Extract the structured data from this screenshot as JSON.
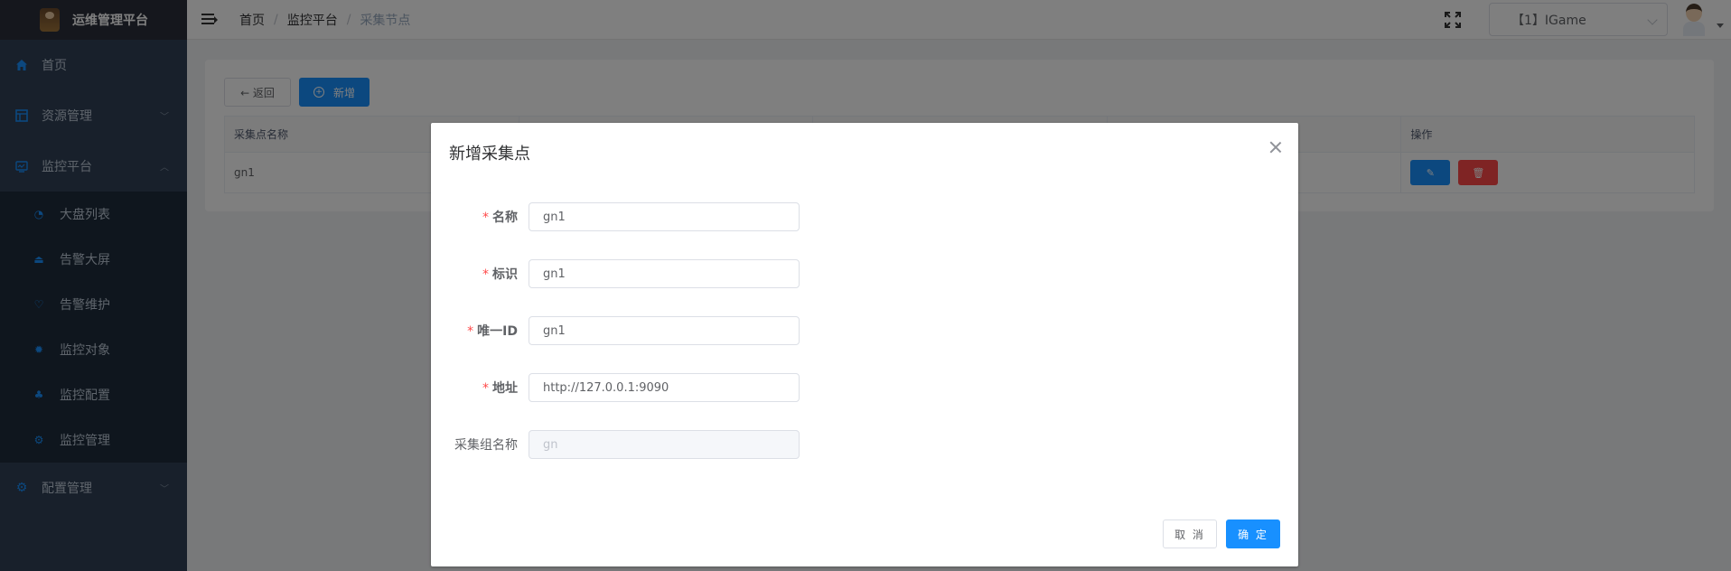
{
  "app": {
    "title": "运维管理平台"
  },
  "sidebar": {
    "items": [
      {
        "label": "首页",
        "icon": "home-icon"
      },
      {
        "label": "资源管理",
        "icon": "table-icon"
      },
      {
        "label": "监控平台",
        "icon": "monitor-icon"
      },
      {
        "label": "配置管理",
        "icon": "settings-icon"
      }
    ],
    "monitor_sub": [
      {
        "label": "大盘列表",
        "icon": "dashboard-icon"
      },
      {
        "label": "告警大屏",
        "icon": "alarm-screen-icon"
      },
      {
        "label": "告警维护",
        "icon": "alarm-maintain-icon"
      },
      {
        "label": "监控对象",
        "icon": "target-icon"
      },
      {
        "label": "监控配置",
        "icon": "config-icon"
      },
      {
        "label": "监控管理",
        "icon": "manage-icon"
      }
    ]
  },
  "navbar": {
    "breadcrumb": [
      "首页",
      "监控平台",
      "采集节点"
    ],
    "breadcrumb_sep": "/",
    "project": "【1】IGame"
  },
  "main": {
    "back_label": "← 返回",
    "add_label": "新增",
    "columns": [
      "采集点名称",
      "",
      "",
      "",
      "操作"
    ],
    "rows": [
      {
        "name": "gn1"
      }
    ]
  },
  "modal": {
    "title": "新增采集点",
    "fields": [
      {
        "label": "名称",
        "required": "*",
        "value": "gn1"
      },
      {
        "label": "标识",
        "required": "*",
        "value": "gn1"
      },
      {
        "label": "唯一ID",
        "required": "*",
        "value": "gn1"
      },
      {
        "label": "地址",
        "required": "*",
        "value": "http://127.0.0.1:9090"
      },
      {
        "label": "采集组名称",
        "required": "",
        "value": "gn"
      }
    ],
    "cancel_label": "取 消",
    "ok_label": "确 定"
  },
  "colors": {
    "primary": "#1890ff",
    "danger": "#ff4949",
    "sidebar_bg": "#304156",
    "submenu_bg": "#1f2d3d"
  }
}
